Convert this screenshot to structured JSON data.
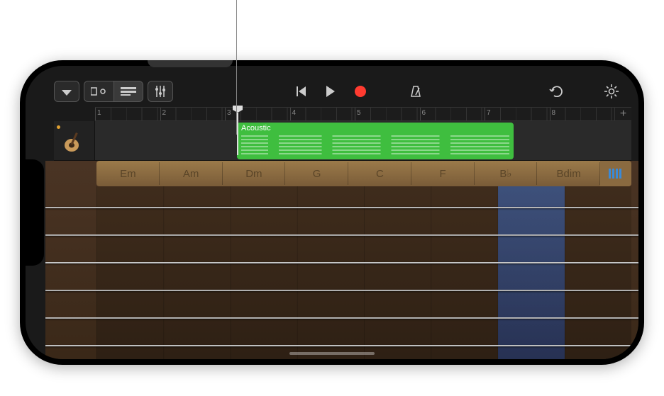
{
  "toolbar": {
    "browser_icon": "browser-menu",
    "fx_icon": "fx-panel",
    "track_view_icon": "track-view",
    "mixer_icon": "mixer-sliders",
    "prev_icon": "go-to-start",
    "play_icon": "play",
    "record_icon": "record",
    "metronome_icon": "metronome",
    "undo_icon": "undo",
    "settings_icon": "settings-gear"
  },
  "ruler": {
    "bars": [
      "1",
      "2",
      "3",
      "4",
      "5",
      "6",
      "7",
      "8"
    ],
    "add_label": "+"
  },
  "track": {
    "instrument": "Acoustic Guitar",
    "region_name": "Acoustic"
  },
  "chords": [
    "Em",
    "Am",
    "Dm",
    "G",
    "C",
    "F",
    "B♭",
    "Bdim"
  ],
  "highlighted_chord_index": 6,
  "strings_count": 6,
  "colors": {
    "region": "#3fbe3f",
    "record": "#ff3b30",
    "highlight": "#3a6ec8"
  }
}
